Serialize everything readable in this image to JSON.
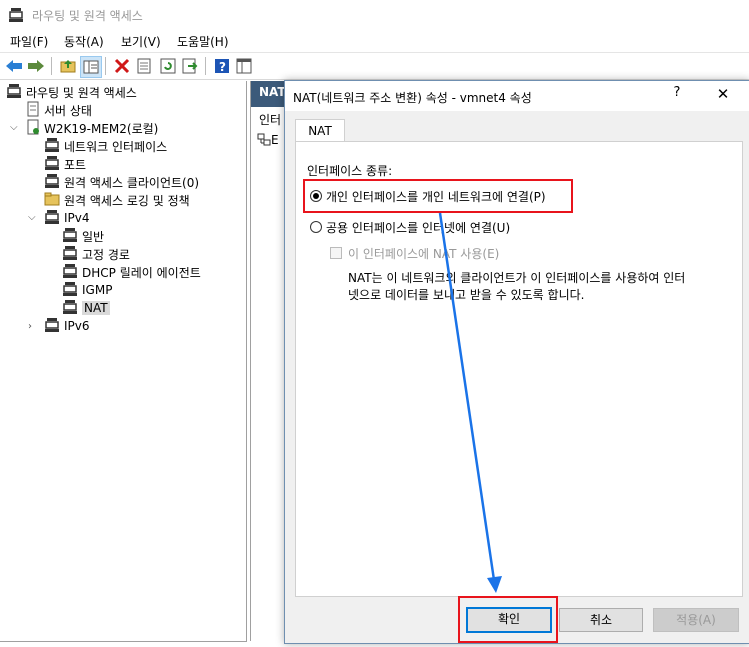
{
  "window": {
    "title": "라우팅 및 원격 액세스"
  },
  "menu": [
    {
      "label": "파일(F)"
    },
    {
      "label": "동작(A)"
    },
    {
      "label": "보기(V)"
    },
    {
      "label": "도움말(H)"
    }
  ],
  "toolbar": {
    "icons": [
      "back-arrow-icon",
      "forward-arrow-icon",
      "up-folder-icon",
      "show-hide-tree-icon",
      "delete-icon",
      "properties-icon",
      "refresh-icon",
      "export-icon",
      "help-icon",
      "console-icon"
    ]
  },
  "tree": {
    "root": "라우팅 및 원격 액세스",
    "server_status": "서버 상태",
    "server": "W2K19-MEM2(로컬)",
    "network_interfaces": "네트워크 인터페이스",
    "ports": "포트",
    "remote_clients": "원격 액세스 클라이언트(0)",
    "logging_policy": "원격 액세스 로깅 및 정책",
    "ipv4": "IPv4",
    "general": "일반",
    "static_routes": "고정 경로",
    "dhcp_relay": "DHCP 릴레이 에이전트",
    "igmp": "IGMP",
    "nat": "NAT",
    "ipv6": "IPv6"
  },
  "right_pane": {
    "header": "NAT",
    "col_label": "인터",
    "row_label": "E"
  },
  "dialog": {
    "title": "NAT(네트워크 주소 변환) 속성 - vmnet4 속성",
    "help": "?",
    "close": "✕",
    "tab": "NAT",
    "group_label": "인터페이스 종류:",
    "option_private": "개인 인터페이스를 개인 네트워크에 연결(P)",
    "option_public": "공용 인터페이스를 인터넷에 연결(U)",
    "checkbox_nat": "이 인터페이스에 NAT 사용(E)",
    "description_line1": "NAT는 이 네트워크의 클라이언트가 이 인터페이스를 사용하여 인터",
    "description_line2": "넷으로 데이터를 보내고 받을 수 있도록 합니다.",
    "ok": "확인",
    "cancel": "취소",
    "apply": "적용(A)"
  },
  "colors": {
    "highlight": "#e8141c",
    "arrow": "#1a73e8",
    "accent": "#0078d7"
  }
}
